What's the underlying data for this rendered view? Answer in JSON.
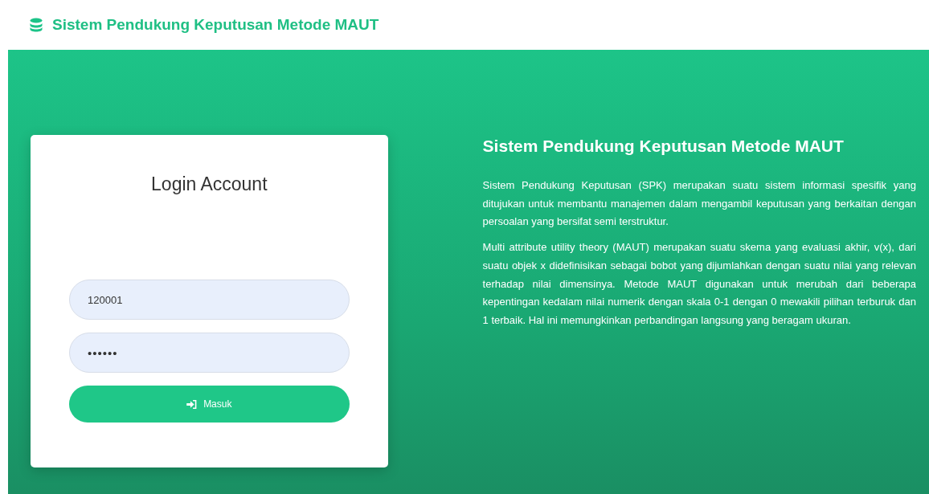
{
  "navbar": {
    "brand": "Sistem Pendukung Keputusan Metode MAUT"
  },
  "login": {
    "title": "Login Account",
    "fields": [
      {
        "kind": "text",
        "value": "120001"
      },
      {
        "kind": "password",
        "value": "••••••"
      }
    ],
    "button": "Masuk"
  },
  "info": {
    "title": "Sistem Pendukung Keputusan Metode MAUT",
    "paragraphs": [
      "Sistem Pendukung Keputusan (SPK) merupakan suatu sistem informasi spesifik yang ditujukan untuk membantu manajemen dalam mengambil keputusan yang berkaitan dengan persoalan yang bersifat semi terstruktur.",
      "Multi attribute utility theory (MAUT) merupakan suatu skema yang evaluasi akhir, v(x), dari suatu objek x didefinisikan sebagai bobot yang dijumlahkan dengan suatu nilai yang relevan terhadap nilai dimensinya. Metode MAUT digunakan untuk merubah dari beberapa kepentingan kedalam nilai numerik dengan skala 0-1 dengan 0 mewakili pilihan terburuk dan 1 terbaik. Hal ini memungkinkan perbandingan langsung yang beragam ukuran."
    ]
  }
}
